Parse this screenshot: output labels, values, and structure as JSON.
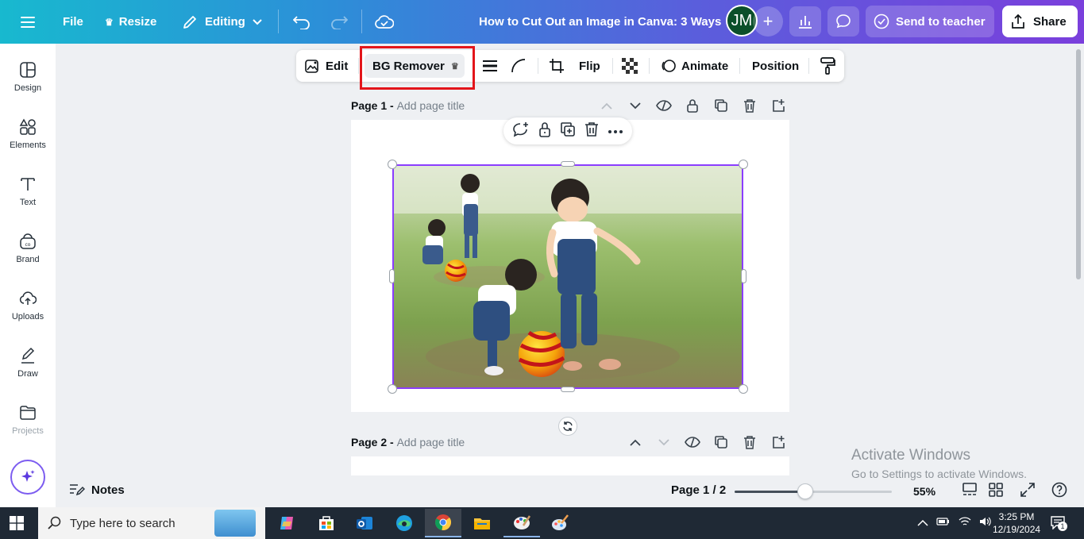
{
  "topbar": {
    "file_label": "File",
    "resize_label": "Resize",
    "editing_label": "Editing",
    "doc_title": "How to Cut Out an Image in Canva: 3 Ways",
    "avatar_initials": "JM",
    "send_label": "Send to teacher",
    "share_label": "Share"
  },
  "sidebar": {
    "items": [
      {
        "label": "Design",
        "icon": "layout-icon"
      },
      {
        "label": "Elements",
        "icon": "shapes-icon"
      },
      {
        "label": "Text",
        "icon": "text-icon"
      },
      {
        "label": "Brand",
        "icon": "brand-icon"
      },
      {
        "label": "Uploads",
        "icon": "cloud-upload-icon"
      },
      {
        "label": "Draw",
        "icon": "pen-icon"
      },
      {
        "label": "Projects",
        "icon": "folder-icon"
      }
    ]
  },
  "context_toolbar": {
    "edit_label": "Edit",
    "bg_remover_label": "BG Remover",
    "flip_label": "Flip",
    "animate_label": "Animate",
    "position_label": "Position"
  },
  "pages": [
    {
      "label": "Page 1 -",
      "subtitle": "Add page title"
    },
    {
      "label": "Page 2 -",
      "subtitle": "Add page title"
    }
  ],
  "bottom": {
    "notes_label": "Notes",
    "page_info": "Page 1 / 2",
    "zoom_value": "55%",
    "zoom_fraction": 0.45
  },
  "watermark": {
    "line1": "Activate Windows",
    "line2": "Go to Settings to activate Windows."
  },
  "taskbar": {
    "search_placeholder": "Type here to search",
    "time": "3:25 PM",
    "date": "12/19/2024",
    "notification_count": "1"
  },
  "colors": {
    "accent": "#8b3dff",
    "highlight": "#e3151a",
    "avatar_bg": "#0b4f2a"
  }
}
